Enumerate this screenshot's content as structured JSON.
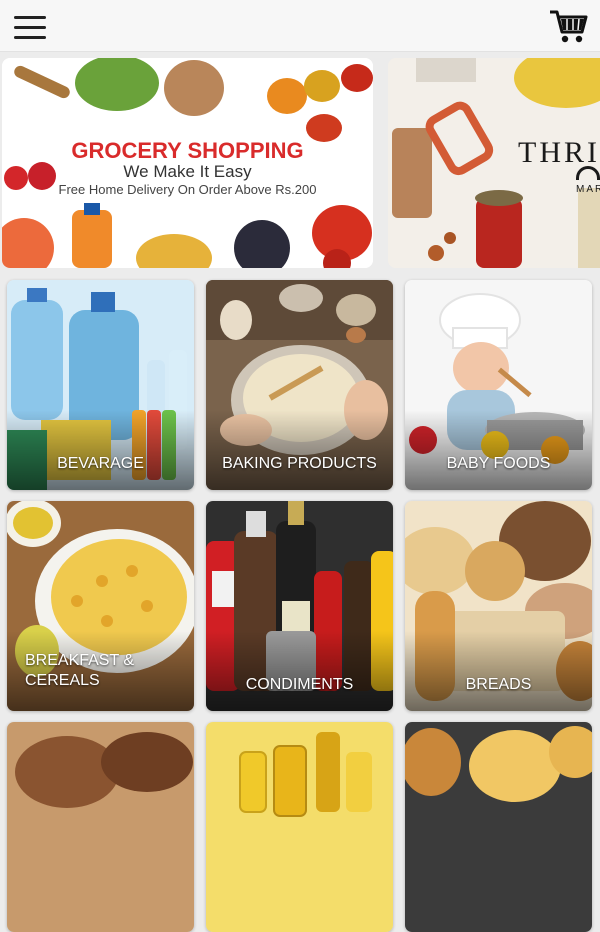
{
  "header": {
    "menu_icon": "hamburger-menu-icon",
    "cart_icon": "shopping-cart-icon"
  },
  "banners": [
    {
      "title": "GROCERY SHOPPING",
      "subtitle": "We Make It Easy",
      "note": "Free Home Delivery On Order Above Rs.200",
      "title_color": "#d92b2b"
    },
    {
      "brand": "THRIV",
      "brand_sub": "MARKET"
    }
  ],
  "categories": [
    {
      "label": "BEVARAGE",
      "color": "#6fb4de"
    },
    {
      "label": "BAKING PRODUCTS",
      "color": "#8a6e52"
    },
    {
      "label": "BABY FOODS",
      "color": "#e8e8e8"
    },
    {
      "label": "BREAKFAST & CEREALS",
      "color": "#9a6a3c"
    },
    {
      "label": "CONDIMENTS",
      "color": "#3a3a3a"
    },
    {
      "label": "BREADS",
      "color": "#e4cfa6"
    },
    {
      "label": "",
      "color": "#b5845a"
    },
    {
      "label": "",
      "color": "#f0d24a"
    },
    {
      "label": "",
      "color": "#3b3b3b"
    }
  ]
}
